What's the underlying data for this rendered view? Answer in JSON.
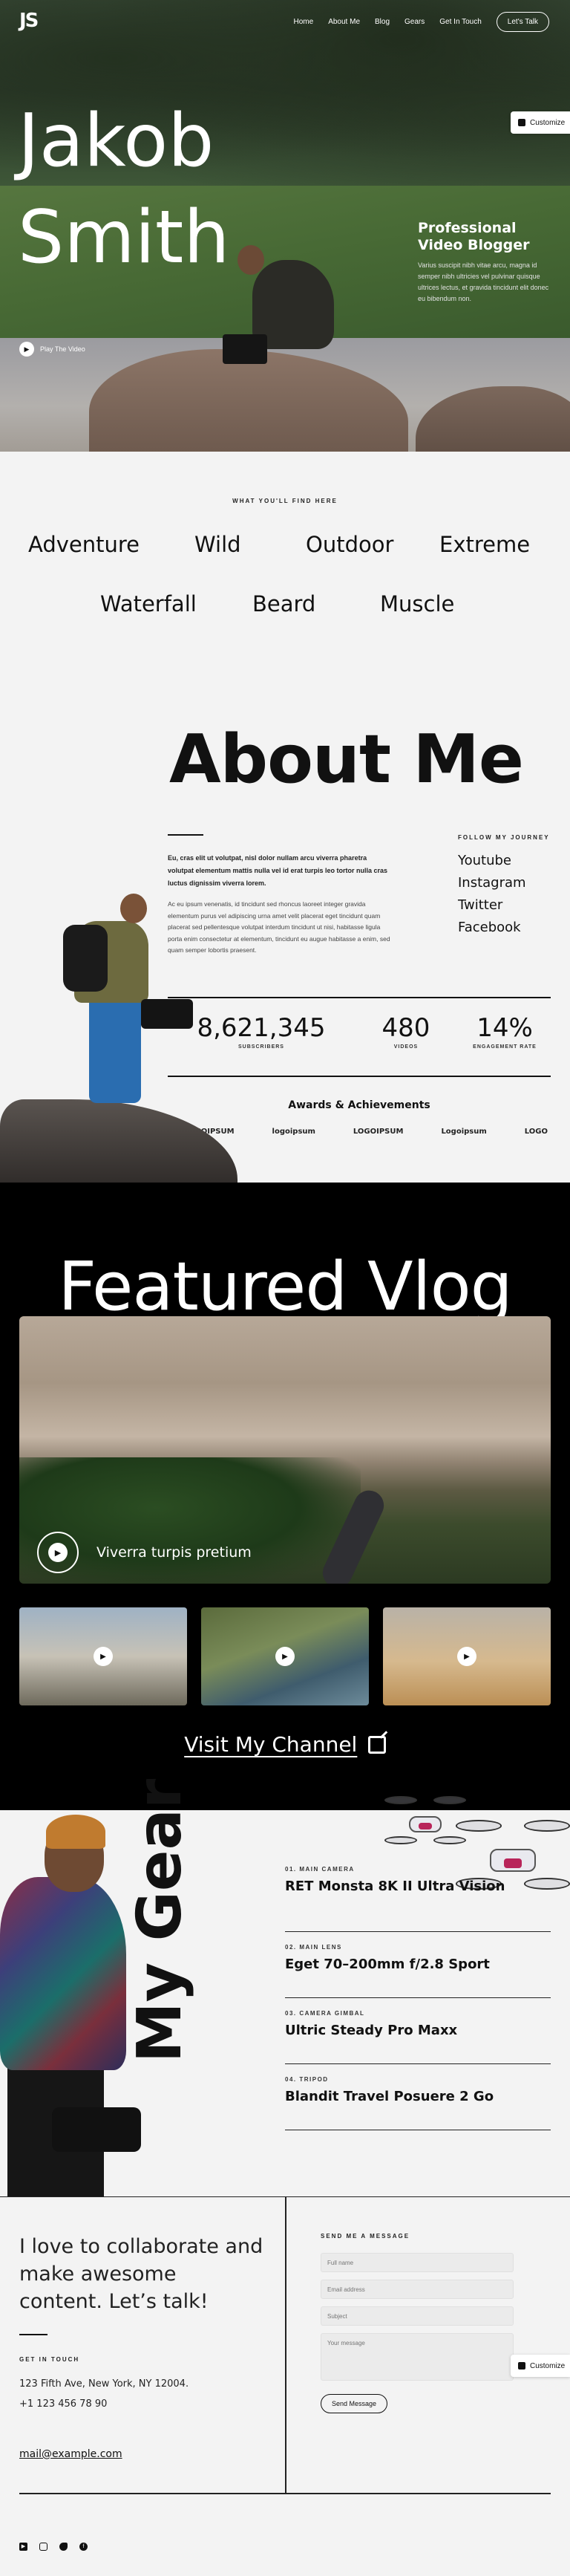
{
  "header": {
    "logo": "JS",
    "nav": [
      "Home",
      "About Me",
      "Blog",
      "Gears",
      "Get In Touch"
    ],
    "cta": "Let's Talk",
    "customize": "Customize"
  },
  "hero": {
    "title_line1": "Jakob",
    "title_line2": "Smith",
    "subtitle": "Professional Video Blogger",
    "text": "Varius suscipit nibh vitae arcu, magna id semper nibh ultricies vel pulvinar quisque ultrices lectus, et gravida tincidunt elit donec eu bibendum non.",
    "play_label": "Play The Video"
  },
  "find": {
    "eyebrow": "WHAT YOU'LL FIND HERE",
    "topics": [
      "Adventure",
      "Wild",
      "Outdoor",
      "Extreme",
      "Waterfall",
      "Beard",
      "Muscle"
    ]
  },
  "about": {
    "title": "About Me",
    "bold": "Eu, cras elit ut volutpat, nisl dolor nullam arcu viverra pharetra volutpat elementum mattis nulla vel id erat turpis leo tortor nulla cras luctus dignissim viverra lorem.",
    "body": "Ac eu ipsum venenatis, id tincidunt sed rhoncus laoreet integer gravida elementum purus vel adipiscing urna amet velit placerat eget tincidunt quam placerat sed pellentesque volutpat interdum tincidunt ut nisi, habitasse ligula porta enim consectetur at elementum, tincidunt eu augue habitasse a enim, sed quam semper lobortis praesent.",
    "follow_label": "FOLLOW MY JOURNEY",
    "social_links": [
      "Youtube",
      "Instagram",
      "Twitter",
      "Facebook"
    ],
    "stats": [
      {
        "value": "8,621,345",
        "label": "SUBSCRIBERS"
      },
      {
        "value": "480",
        "label": "VIDEOS"
      },
      {
        "value": "14%",
        "label": "ENGAGEMENT RATE"
      }
    ],
    "awards_title": "Awards & Achievements",
    "partners": [
      "LOGOIPSUM",
      "logoipsum",
      "LOGOIPSUM",
      "Logoipsum",
      "LOGO"
    ]
  },
  "vlog": {
    "title": "Featured Vlog",
    "caption": "Viverra turpis pretium",
    "channel_link": "Visit My Channel"
  },
  "gear": {
    "title": "My Gear",
    "items": [
      {
        "number": "01. MAIN CAMERA",
        "name": "RET Monsta 8K II Ultra Vision"
      },
      {
        "number": "02. MAIN LENS",
        "name": "Eget 70–200mm f/2.8 Sport"
      },
      {
        "number": "03. CAMERA GIMBAL",
        "name": "Ultric Steady Pro Maxx"
      },
      {
        "number": "04. TRIPOD",
        "name": "Blandit Travel Posuere 2 Go"
      }
    ]
  },
  "contact": {
    "heading": "I love to collaborate and make awesome content. Let’s talk!",
    "get_in_touch": "GET IN TOUCH",
    "address": "123 Fifth Ave, New York, NY 12004.",
    "phone": "+1 123 456 78 90",
    "email": "mail@example.com",
    "form_label": "SEND ME A MESSAGE",
    "fields": {
      "name_placeholder": "Full name",
      "email_placeholder": "Email address",
      "subject_placeholder": "Subject",
      "message_placeholder": "Your message"
    },
    "send_label": "Send Message"
  },
  "footer": {
    "social_icons": [
      "youtube-icon",
      "instagram-icon",
      "twitter-icon",
      "facebook-icon"
    ]
  },
  "colors": {
    "accent": "#111111",
    "background": "#f3f3f3",
    "vlog_background": "#000000"
  }
}
